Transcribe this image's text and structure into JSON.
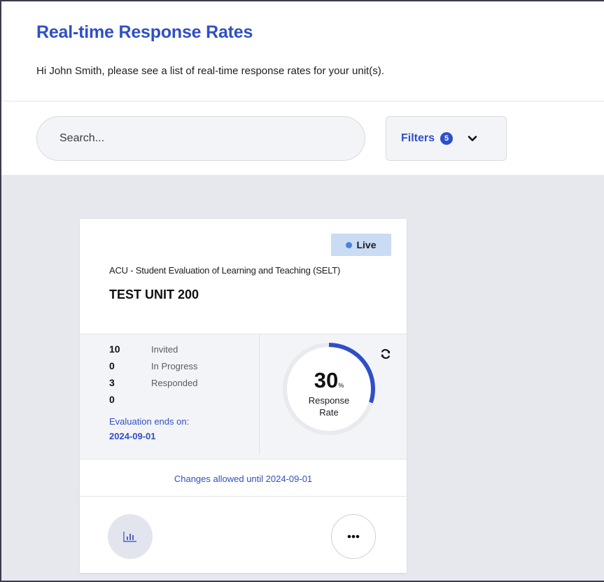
{
  "page": {
    "title": "Real-time Response Rates",
    "subtitle": "Hi John Smith, please see a list of real-time response rates for your unit(s)."
  },
  "search": {
    "placeholder": "Search..."
  },
  "filters": {
    "label": "Filters",
    "count": "5"
  },
  "card": {
    "status": "Live",
    "survey": "ACU - Student Evaluation of Learning and Teaching (SELT)",
    "unit": "TEST UNIT 200",
    "stats": [
      {
        "value": "10",
        "label": "Invited"
      },
      {
        "value": "0",
        "label": "In Progress"
      },
      {
        "value": "3",
        "label": "Responded"
      },
      {
        "value": "0",
        "label": ""
      }
    ],
    "evaluation_ends_label": "Evaluation ends on:",
    "evaluation_ends_date": "2024-09-01",
    "response_rate": "30",
    "response_rate_symbol": "%",
    "response_label_1": "Response",
    "response_label_2": "Rate",
    "changes_note": "Changes allowed until 2024-09-01"
  },
  "icons": {
    "filters_chevron": "chevron-down-icon",
    "refresh": "refresh-icon",
    "chart": "bar-chart-icon",
    "more": "more-horizontal-icon"
  },
  "colors": {
    "accent": "#2f4fc7",
    "live_badge_bg": "#c9dcf3",
    "live_dot": "#4a83d9",
    "content_bg": "#e6e8ee"
  }
}
